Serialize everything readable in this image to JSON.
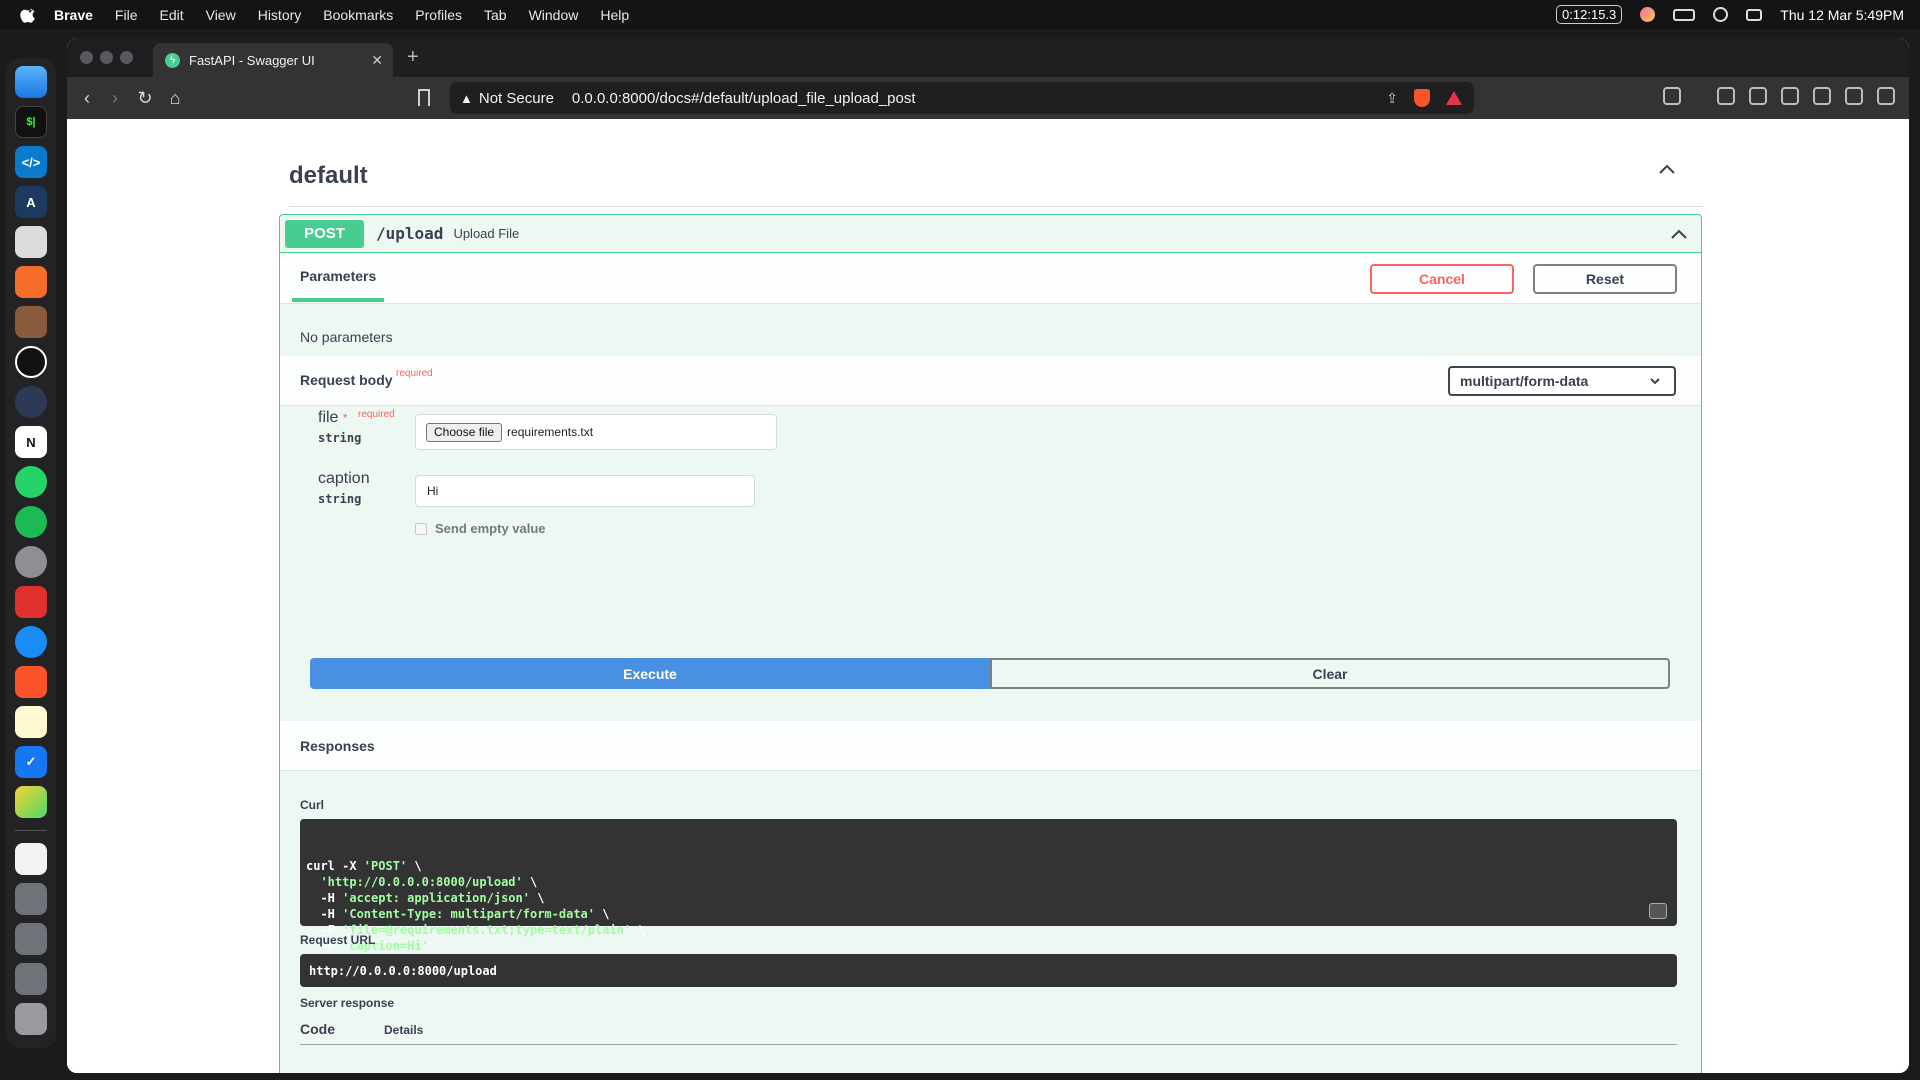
{
  "menubar": {
    "app_name": "Brave",
    "items": [
      "File",
      "Edit",
      "View",
      "History",
      "Bookmarks",
      "Profiles",
      "Tab",
      "Window",
      "Help"
    ],
    "timer": "0:12:15.3",
    "datetime": "Thu 12 Mar  5:49PM"
  },
  "browser": {
    "tab_title": "FastAPI - Swagger UI",
    "security_label": "Not Secure",
    "url": "0.0.0.0:8000/docs#/default/upload_file_upload_post"
  },
  "swagger": {
    "section_title": "default",
    "method": "POST",
    "path": "/upload",
    "summary": "Upload File",
    "params_tab": "Parameters",
    "cancel_label": "Cancel",
    "reset_label": "Reset",
    "no_params": "No parameters",
    "request_body_label": "Request body",
    "required_label": "required",
    "content_type": "multipart/form-data",
    "fields": {
      "file": {
        "name": "file",
        "star": "*",
        "required": "required",
        "type": "string",
        "button": "Choose file",
        "value": "requirements.txt"
      },
      "caption": {
        "name": "caption",
        "type": "string",
        "value": "Hi"
      }
    },
    "send_empty_label": "Send empty value",
    "execute_label": "Execute",
    "clear_label": "Clear",
    "responses_title": "Responses",
    "curl_label": "Curl",
    "curl_lines": [
      {
        "pre": "curl -X ",
        "str": "'POST'",
        "post": " \\"
      },
      {
        "pre": "  ",
        "str": "'http://0.0.0.0:8000/upload'",
        "post": " \\"
      },
      {
        "pre": "  -H ",
        "str": "'accept: application/json'",
        "post": " \\"
      },
      {
        "pre": "  -H ",
        "str": "'Content-Type: multipart/form-data'",
        "post": " \\"
      },
      {
        "pre": "  -F ",
        "str": "'file=@requirements.txt;type=text/plain'",
        "post": " \\"
      },
      {
        "pre": "  -F ",
        "str": "'caption=Hi'",
        "post": ""
      }
    ],
    "request_url_label": "Request URL",
    "request_url": "http://0.0.0.0:8000/upload",
    "server_response_label": "Server response",
    "code_header": "Code",
    "details_header": "Details"
  },
  "colors": {
    "post_green": "#49cc90",
    "execute_blue": "#4990e2",
    "cancel_red": "#ff6060"
  },
  "dock_icons": [
    "finder-icon",
    "terminal-icon",
    "vscode-icon",
    "xcode-icon",
    "app-icon",
    "brush-icon",
    "app2-icon",
    "chatgpt-icon",
    "app3-icon",
    "notion-icon",
    "whatsapp-icon",
    "spotify-icon",
    "settings-icon",
    "app4-icon",
    "safari-icon",
    "brave-icon",
    "notes-icon",
    "todo-icon",
    "app5-icon"
  ]
}
